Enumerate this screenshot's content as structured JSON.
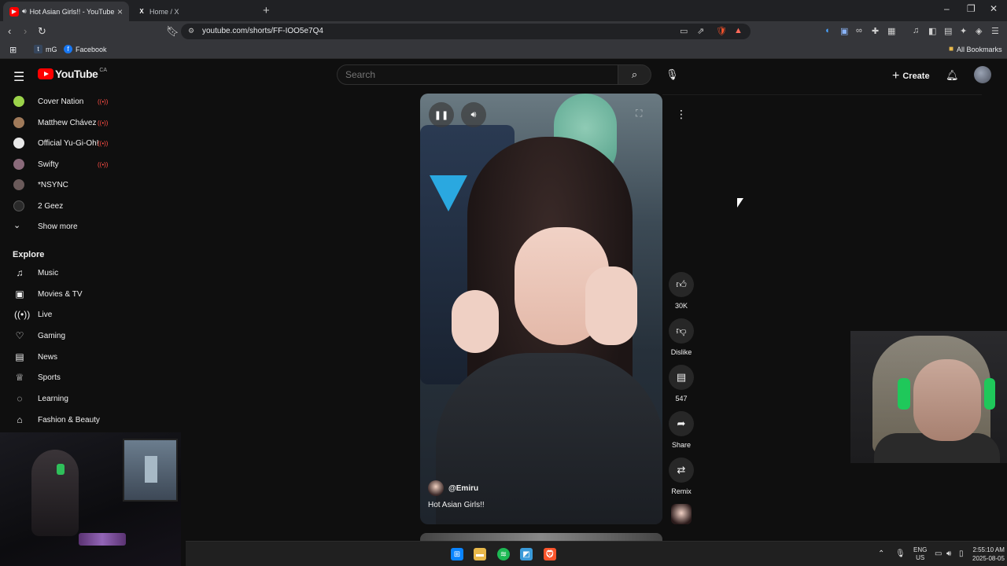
{
  "browser": {
    "tabs": [
      {
        "title": "Hot Asian Girls!! - YouTube",
        "active": true
      },
      {
        "title": "Home / X",
        "active": false
      }
    ],
    "url": "youtube.com/shorts/FF-IOO5e7Q4",
    "bookmarks": [
      {
        "label": "mG",
        "icon": "tumblr-icon"
      },
      {
        "label": "Facebook",
        "icon": "facebook-icon"
      }
    ],
    "all_bookmarks": "All Bookmarks"
  },
  "masthead": {
    "logo_text": "YouTube",
    "country": "CA",
    "search_placeholder": "Search",
    "create_label": "Create"
  },
  "sidebar": {
    "subscriptions": [
      {
        "name": "Cover Nation",
        "live": true,
        "color": "#9bd34a"
      },
      {
        "name": "Matthew Chávez",
        "live": true,
        "color": "#a07a5a"
      },
      {
        "name": "Official Yu-Gi-Oh!",
        "live": true,
        "color": "#e8e8e8"
      },
      {
        "name": "Swifty",
        "live": true,
        "color": "#8a6a7a"
      },
      {
        "name": "*NSYNC",
        "live": false,
        "color": "#6a5a5a"
      },
      {
        "name": "2 Geez",
        "live": false,
        "color": "#2a2a2a"
      }
    ],
    "show_more": "Show more",
    "explore_title": "Explore",
    "explore": [
      {
        "name": "Music",
        "icon": "music-note-icon"
      },
      {
        "name": "Movies & TV",
        "icon": "clapperboard-icon"
      },
      {
        "name": "Live",
        "icon": "live-icon"
      },
      {
        "name": "Gaming",
        "icon": "gamepad-icon"
      },
      {
        "name": "News",
        "icon": "newspaper-icon"
      },
      {
        "name": "Sports",
        "icon": "trophy-icon"
      },
      {
        "name": "Learning",
        "icon": "lightbulb-icon"
      },
      {
        "name": "Fashion & Beauty",
        "icon": "hanger-icon"
      }
    ]
  },
  "short": {
    "channel": "@Emiru",
    "title": "Hot Asian Girls!!",
    "actions": {
      "like_count": "30K",
      "dislike_label": "Dislike",
      "comments_count": "547",
      "share_label": "Share",
      "remix_label": "Remix"
    }
  },
  "taskbar": {
    "lang_top": "ENG",
    "lang_bottom": "US",
    "time": "2:55:10 AM",
    "date": "2025-08-05"
  },
  "colors": {
    "accent": "#ff0000",
    "live": "#ff4e45",
    "background": "#0f0f0f"
  }
}
